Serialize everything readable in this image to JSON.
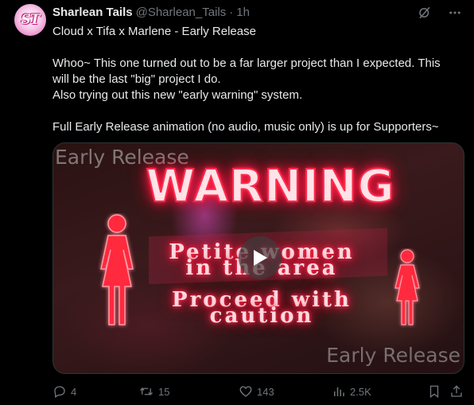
{
  "author": {
    "display_name": "Sharlean Tails",
    "handle": "@Sharlean_Tails",
    "separator": "·",
    "time": "1h",
    "avatar_text": "ST"
  },
  "tweet": {
    "line1": "Cloud x Tifa x Marlene - Early Release",
    "line2": "Whoo~ This one turned out to be a far larger project than I expected. This will be the last \"big\" project I do.",
    "line3": "Also trying out this new \"early warning\" system.",
    "line4": "Full Early Release animation (no audio, music only) is up for Supporters~"
  },
  "media": {
    "watermark_top": "Early Release",
    "headline": "WARNING",
    "msg1": "Petite women",
    "msg2": "in the area",
    "msg3": "Proceed with",
    "msg4": "caution",
    "watermark_bottom": "Early Release"
  },
  "actions": {
    "replies": "4",
    "reposts": "15",
    "likes": "143",
    "views": "2.5K"
  },
  "icons": {
    "grok": "grok-icon",
    "more": "more-icon",
    "reply": "reply-icon",
    "repost": "repost-icon",
    "like": "heart-icon",
    "views": "views-icon",
    "bookmark": "bookmark-icon",
    "share": "share-icon",
    "play": "play-icon"
  },
  "colors": {
    "background": "#000000",
    "text": "#e7e9ea",
    "muted": "#71767b",
    "neon": "#ff2c4b"
  }
}
